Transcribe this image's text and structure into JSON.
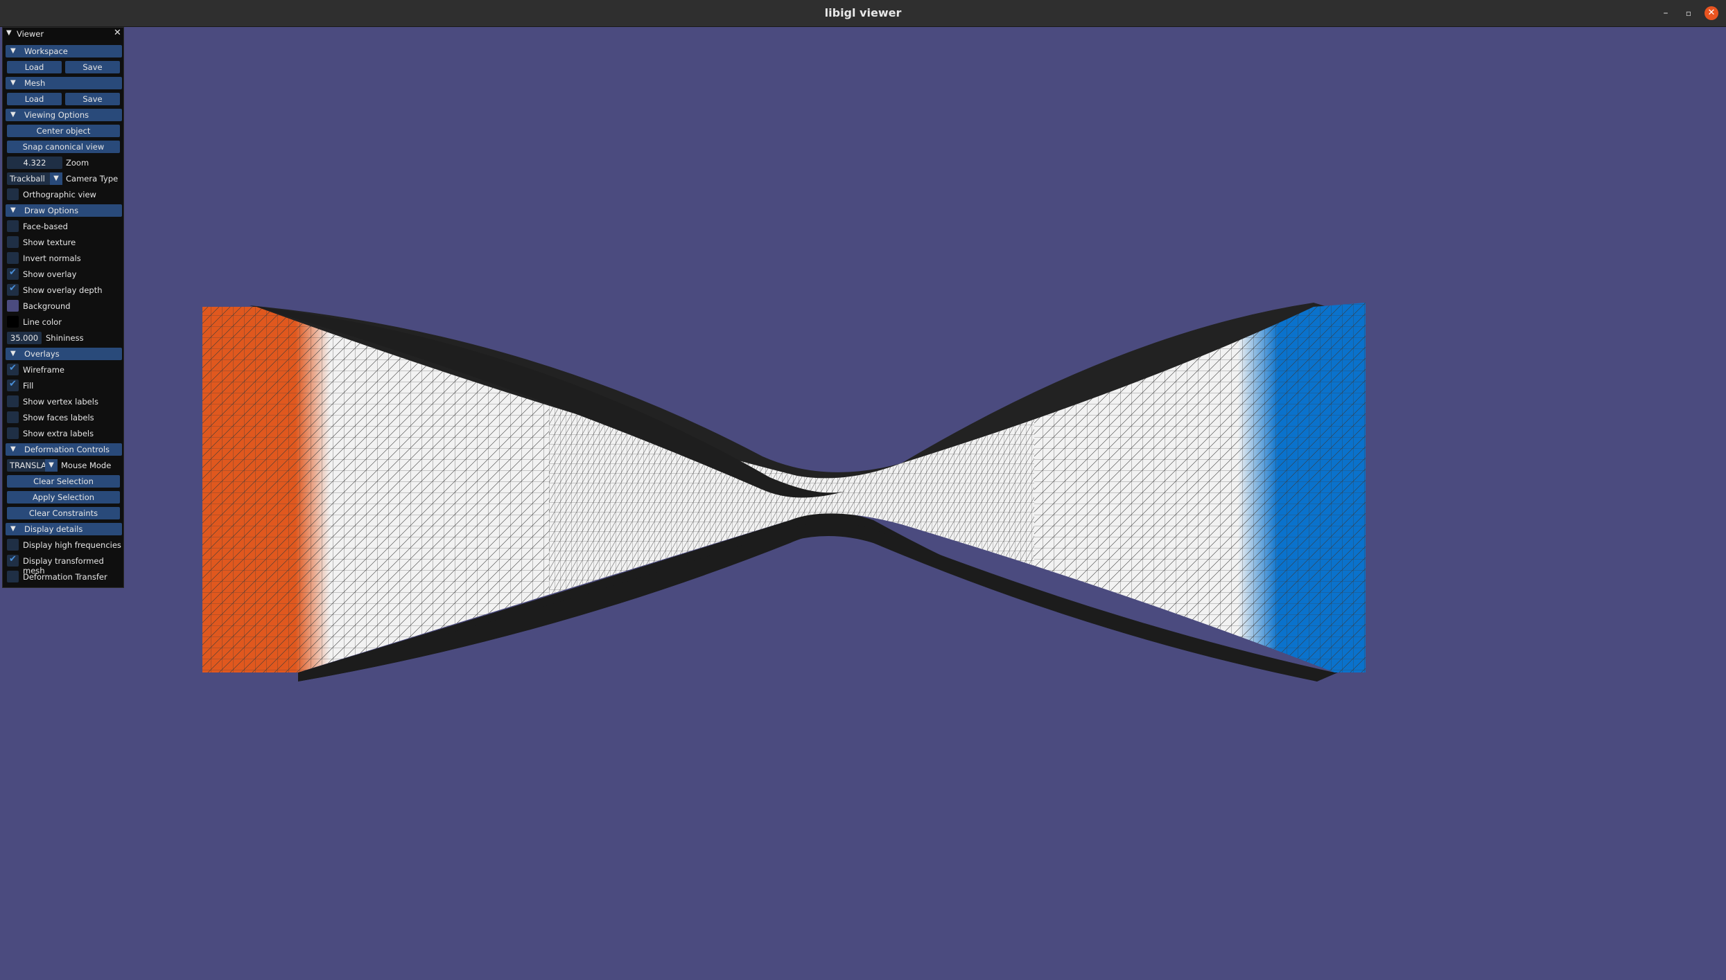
{
  "window": {
    "title": "libigl viewer",
    "minimize": "–",
    "maximize": "▫",
    "close": "✕"
  },
  "colors": {
    "background": "#4b4b7f",
    "accent": "#294a7a",
    "handle_left": "#e0581e",
    "handle_right": "#0a72cc"
  },
  "panel": {
    "title": "Viewer",
    "close_icon": "✕",
    "workspace": {
      "header": "Workspace",
      "load": "Load",
      "save": "Save"
    },
    "mesh": {
      "header": "Mesh",
      "load": "Load",
      "save": "Save"
    },
    "viewing": {
      "header": "Viewing Options",
      "center_object": "Center object",
      "snap_canonical": "Snap canonical view",
      "zoom_value": "4.322",
      "zoom_label": "Zoom",
      "camera_type_value": "Trackball",
      "camera_type_label": "Camera Type",
      "orthographic": "Orthographic view"
    },
    "draw": {
      "header": "Draw Options",
      "face_based": "Face-based",
      "show_texture": "Show texture",
      "invert_normals": "Invert normals",
      "show_overlay": "Show overlay",
      "show_overlay_depth": "Show overlay depth",
      "background": "Background",
      "line_color": "Line color",
      "shininess_value": "35.000",
      "shininess_label": "Shininess"
    },
    "overlays": {
      "header": "Overlays",
      "wireframe": "Wireframe",
      "fill": "Fill",
      "vertex_labels": "Show vertex labels",
      "faces_labels": "Show faces labels",
      "extra_labels": "Show extra labels"
    },
    "deformation": {
      "header": "Deformation Controls",
      "mouse_mode_value": "TRANSLAT",
      "mouse_mode_label": "Mouse Mode",
      "clear_selection": "Clear Selection",
      "apply_selection": "Apply Selection",
      "clear_constraints": "Clear Constraints"
    },
    "display": {
      "header": "Display details",
      "high_freq": "Display high frequencies",
      "transformed_mesh": "Display transformed mesh",
      "deformation_transfer": "Deformation Transfer"
    },
    "checked": {
      "orthographic": false,
      "face_based": false,
      "show_texture": false,
      "invert_normals": false,
      "show_overlay": true,
      "show_overlay_depth": true,
      "wireframe": true,
      "fill": true,
      "vertex_labels": false,
      "faces_labels": false,
      "extra_labels": false,
      "high_freq": false,
      "transformed_mesh": true,
      "deformation_transfer": false
    }
  }
}
